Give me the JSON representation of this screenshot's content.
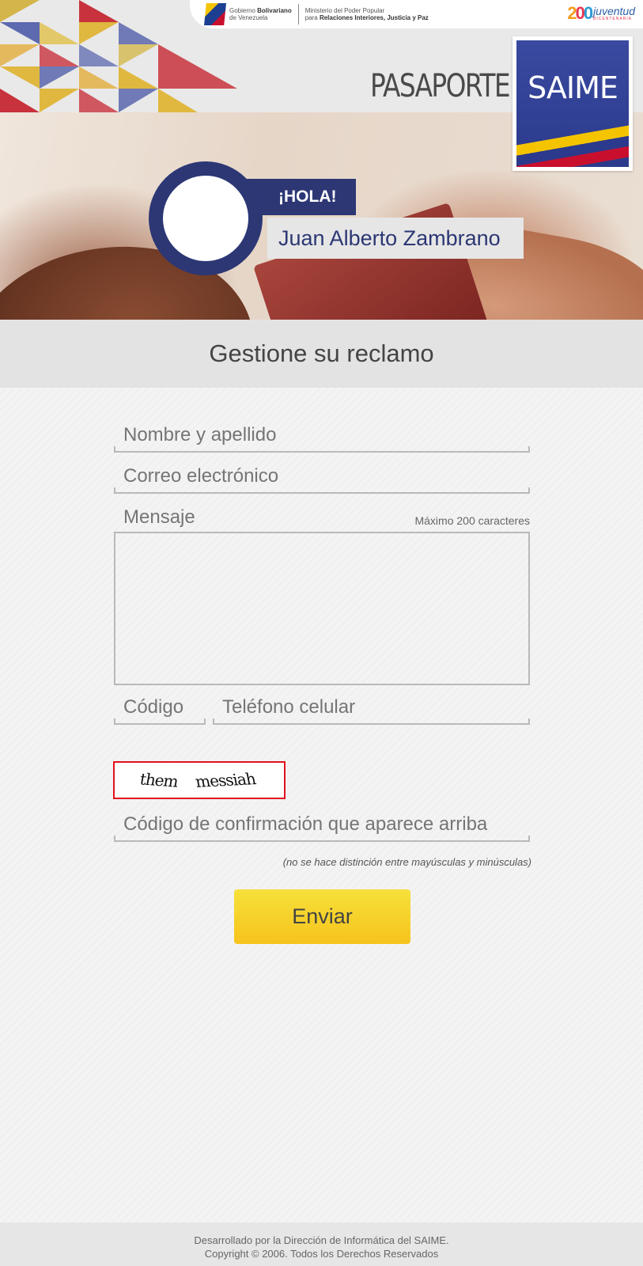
{
  "header": {
    "gov_logo_line1_plain": "Gobierno ",
    "gov_logo_line1_bold": "Bolivariano",
    "gov_logo_line2": "de Venezuela",
    "ministry_line1": "Ministerio del Poder Popular",
    "ministry_line2_plain": "para ",
    "ministry_line2_bold": "Relaciones Interiores, Justicia y Paz",
    "juventud_number": [
      "2",
      "0",
      "0"
    ],
    "juventud_text": "juventud",
    "juventud_sub": "BICENTENARIA",
    "title": "PASAPORTE",
    "saime_logo": "SAIME",
    "greeting": "¡HOLA!",
    "user_name": "Juan Alberto Zambrano"
  },
  "page": {
    "title": "Gestione su reclamo"
  },
  "form": {
    "nombre_placeholder": "Nombre y apellido",
    "correo_placeholder": "Correo electrónico",
    "mensaje_label": "Mensaje",
    "mensaje_max": "Máximo 200 caracteres",
    "codigo_placeholder": "Código",
    "telefono_placeholder": "Teléfono celular",
    "captcha_word1": "them",
    "captcha_word2": "messiah",
    "confirm_placeholder": "Código de confirmación que aparece arriba",
    "case_note": "(no se hace distinción entre mayúsculas y minúsculas)",
    "submit_label": "Enviar"
  },
  "footer": {
    "line1": "Desarrollado por la Dirección de Informática del SAIME.",
    "line2": "Copyright © 2006. Todos los Derechos Reservados"
  },
  "colors": {
    "navy": "#2c3774",
    "button_yellow": "#f7c31d",
    "captcha_border": "#e0121d"
  },
  "icons": [
    "venezuela-flag-icon",
    "juventud-logo-icon",
    "saime-logo-icon",
    "avatar-placeholder-icon"
  ]
}
